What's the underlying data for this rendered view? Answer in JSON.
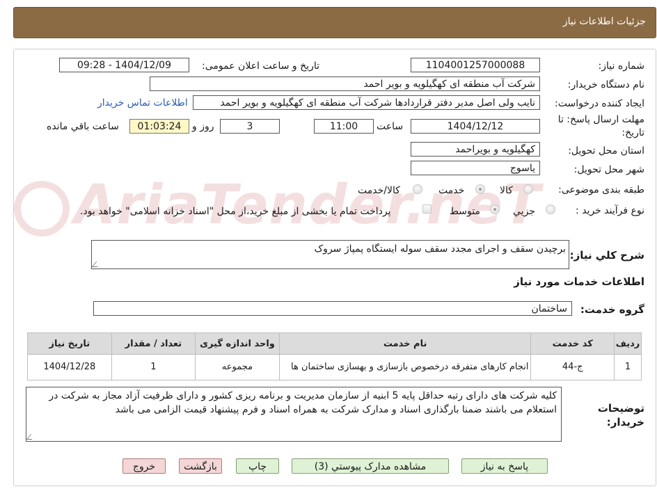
{
  "header": {
    "title": "جزئیات اطلاعات نیاز"
  },
  "fields": {
    "need_number_label": "شماره نیاز:",
    "need_number": "1104001257000088",
    "announce_label": "تاریخ و ساعت اعلان عمومی:",
    "announce_value": "1404/12/09 - 09:28",
    "buyer_org_label": "نام دستگاه خریدار:",
    "buyer_org": "شرکت آب منطقه ای کهگیلویه و بویر احمد",
    "requester_label": "ایجاد کننده درخواست:",
    "requester": "نایب ولی اصل مدیر دفتر قراردادها شرکت آب منطقه ای کهگیلویه و بویر احمد",
    "contact_link": "اطلاعات تماس خریدار",
    "deadline_label_1": "مهلت ارسال پاسخ: تا",
    "deadline_label_2": "تاریخ:",
    "deadline_date": "1404/12/12",
    "time_label": "ساعت",
    "deadline_time": "11:00",
    "days_value": "3",
    "days_label": "روز و",
    "remaining_time": "01:03:24",
    "remaining_label": "ساعت باقي مانده",
    "province_label": "استان محل تحویل:",
    "province": "کهگیلویه و بویراحمد",
    "city_label": "شهر محل تحویل:",
    "city": "یاسوج",
    "category_label": "طبقه بندی موضوعی:",
    "category_options": [
      "کالا",
      "خدمت",
      "کالا/خدمت"
    ],
    "category_selected": "خدمت",
    "process_label": "نوع فرآیند خرید :",
    "process_options": [
      "جزيي",
      "متوسط"
    ],
    "process_selected": "متوسط",
    "payment_note": "پرداخت تمام یا بخشی از مبلغ خرید،از محل \"اسناد خزانه اسلامی\" خواهد بود.",
    "description_label": "شرح کلي نياز:",
    "description": "برچیدن سقف و اجرای مجدد سقف سوله ایستگاه پمپاژ سروک",
    "services_section": "اطلاعات خدمات مورد نیاز",
    "service_group_label": "گروه خدمت:",
    "service_group": "ساختمان",
    "buyer_notes_label_1": "توضیحات",
    "buyer_notes_label_2": "خریدار:",
    "buyer_notes": "کلیه شرکت های دارای  رتبه حداقل پایه 5 ابنیه از سازمان مدیریت و برنامه ریزی کشور و دارای ظرفیت آزاد مجاز به شرکت در استعلام می باشند ضمنا بارگذاری اسناد و مدارک شرکت به همراه اسناد و فرم پیشنهاد قیمت الزامی می باشد"
  },
  "table": {
    "headers": [
      "ردیف",
      "کد خدمت",
      "نام خدمت",
      "واحد اندازه گیری",
      "تعداد / مقدار",
      "تاریخ نیاز"
    ],
    "rows": [
      [
        "1",
        "ج-44",
        "انجام کارهای متفرقه درخصوص بازسازی و بهسازی ساختمان ها",
        "مجموعه",
        "1",
        "1404/12/28"
      ]
    ]
  },
  "buttons": {
    "reply": "پاسخ به نیاز",
    "attachments": "مشاهده مدارک پیوستي (3)",
    "print": "چاپ",
    "back": "بازگشت",
    "exit": "خروج"
  },
  "watermark": "AriaTender.neT",
  "colors": {
    "header": "#8b6b43",
    "highlight": "#fff7c6",
    "link": "#2a5db0"
  }
}
